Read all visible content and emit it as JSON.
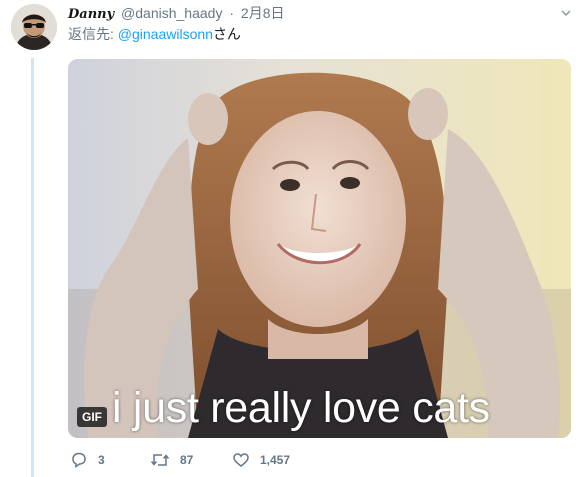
{
  "tweet": {
    "display_name": "Danny",
    "handle": "@danish_haady",
    "separator": "·",
    "time": "2月8日",
    "reply_prefix": "返信先: ",
    "reply_mention": "@ginaawilsonn",
    "reply_suffix": "さん"
  },
  "media": {
    "badge": "GIF",
    "caption": "i just really love cats"
  },
  "actions": {
    "reply_count": "3",
    "retweet_count": "87",
    "like_count": "1,457"
  },
  "colors": {
    "accent": "#1da1f2",
    "muted": "#657786",
    "thread_line": "#cfe6f6"
  }
}
